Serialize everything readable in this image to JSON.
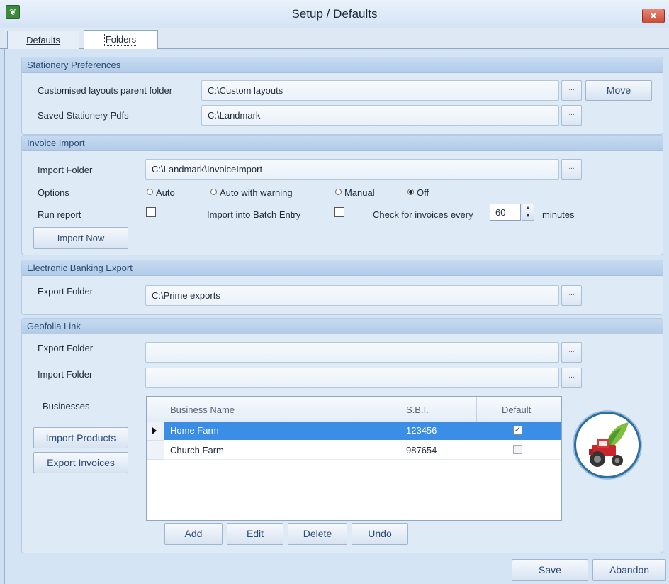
{
  "window": {
    "title": "Setup / Defaults",
    "close_glyph": "✕"
  },
  "tabs": [
    {
      "label": "Defaults",
      "active": false
    },
    {
      "label": "Folders",
      "active": true
    }
  ],
  "stationery": {
    "heading": "Stationery Preferences",
    "custom_label": "Customised layouts parent folder",
    "custom_value": "C:\\Custom layouts",
    "saved_label": "Saved Stationery Pdfs",
    "saved_value": "C:\\Landmark",
    "move_label": "Move",
    "browse_glyph": "..."
  },
  "invoice": {
    "heading": "Invoice Import",
    "folder_label": "Import Folder",
    "folder_value": "C:\\Landmark\\InvoiceImport",
    "options_label": "Options",
    "options": [
      {
        "label": "Auto",
        "selected": false
      },
      {
        "label": "Auto with warning",
        "selected": false
      },
      {
        "label": "Manual",
        "selected": false
      },
      {
        "label": "Off",
        "selected": true
      }
    ],
    "run_report_label": "Run report",
    "run_report_checked": false,
    "batch_label": "Import into Batch Entry",
    "batch_checked": false,
    "check_label": "Check for invoices every",
    "check_value": "60",
    "check_unit": "minutes",
    "import_now_label": "Import Now"
  },
  "banking": {
    "heading": "Electronic Banking Export",
    "folder_label": "Export Folder",
    "folder_value": "C:\\Prime exports"
  },
  "geofolia": {
    "heading": "Geofolia Link",
    "export_label": "Export Folder",
    "export_value": "",
    "import_label": "Import Folder",
    "import_value": "",
    "businesses_label": "Businesses",
    "import_products_label": "Import Products",
    "export_invoices_label": "Export Invoices",
    "columns": [
      "Business Name",
      "S.B.I.",
      "Default"
    ],
    "rows": [
      {
        "name": "Home Farm",
        "sbi": "123456",
        "default": true,
        "selected": true
      },
      {
        "name": "Church Farm",
        "sbi": "987654",
        "default": false,
        "selected": false
      }
    ],
    "add_label": "Add",
    "edit_label": "Edit",
    "delete_label": "Delete",
    "undo_label": "Undo"
  },
  "footer": {
    "save_label": "Save",
    "abandon_label": "Abandon"
  },
  "colors": {
    "selected_row": "#3a8ee6",
    "header_text": "#2a4a72",
    "logo_ring": "#2f6f9f"
  }
}
